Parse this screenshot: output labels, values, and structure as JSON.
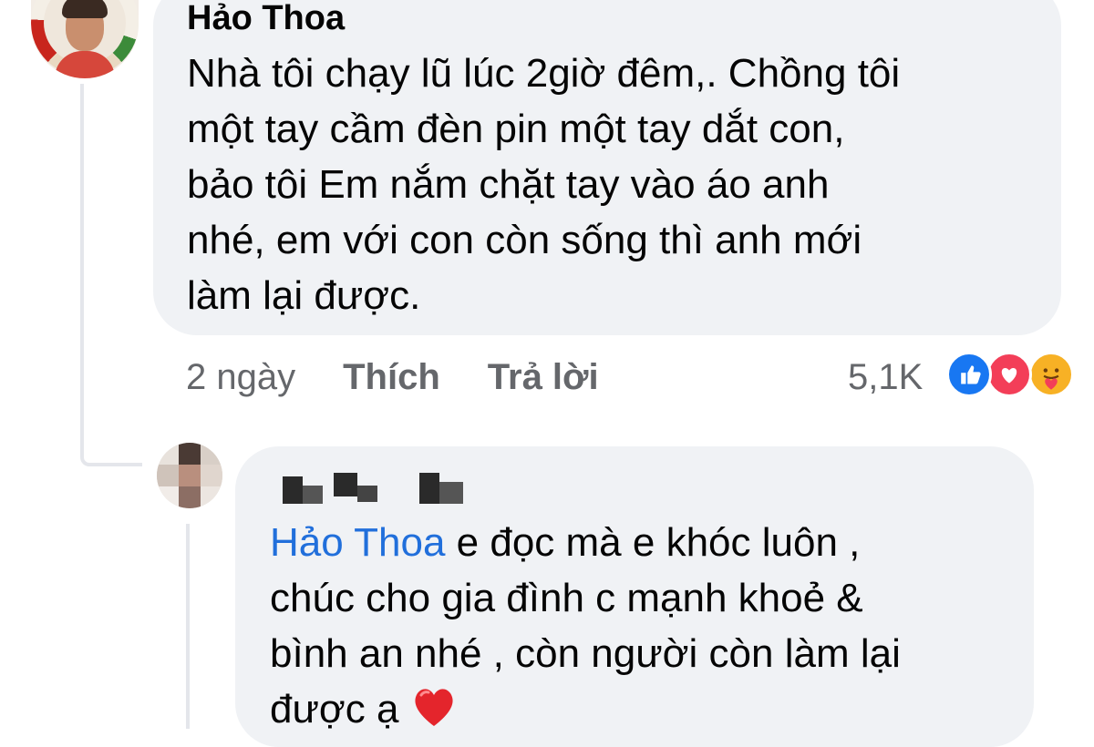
{
  "comment": {
    "author": "Hảo Thoa",
    "text": "Nhà tôi chạy lũ lúc 2giờ đêm,. Chồng tôi\nmột tay cầm đèn pin một tay dắt con,\nbảo tôi Em nắm chặt tay vào áo anh\nnhé, em với con còn sống thì anh mới\nlàm lại được.",
    "time": "2 ngày",
    "like_label": "Thích",
    "reply_label": "Trả lời",
    "reaction_count": "5,1K",
    "reaction_icons": [
      "like-icon",
      "love-icon",
      "care-icon"
    ]
  },
  "reply": {
    "mention": "Hảo Thoa",
    "text": " e đọc mà e khóc luôn ,\nchúc cho gia đình c mạnh khoẻ &\nbình an nhé , còn người còn làm lại\nđược ạ ",
    "emoji": "heart-emoji"
  },
  "colors": {
    "bubble": "#f0f2f5",
    "mention": "#216fdb",
    "meta": "#65676b",
    "like": "#1877f2",
    "love": "#f33e58",
    "care": "#f7b125"
  }
}
